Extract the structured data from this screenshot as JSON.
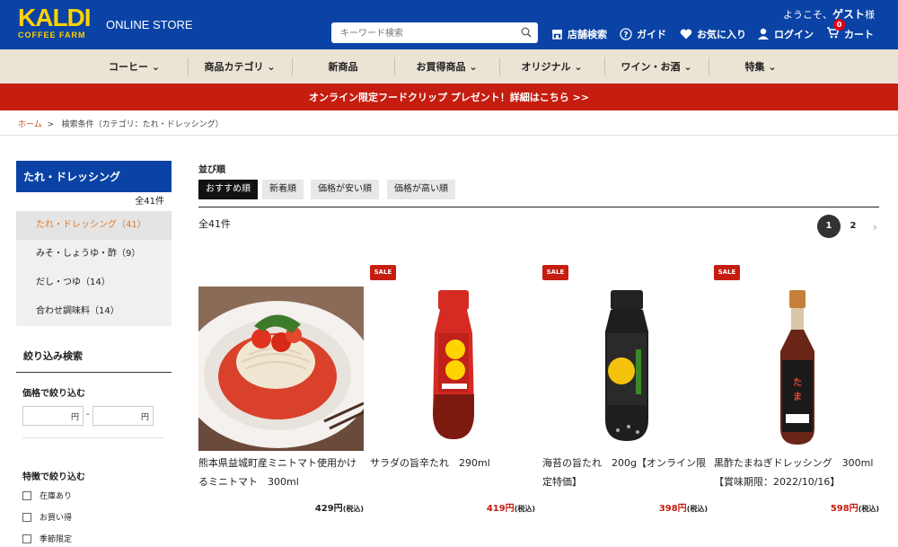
{
  "header": {
    "logo_main": "KALDI",
    "logo_sub": "COFFEE FARM",
    "store_label": "ONLINE STORE",
    "search_placeholder": "キーワード検索",
    "welcome_prefix": "ようこそ、",
    "welcome_user": "ゲスト",
    "welcome_suffix": "様",
    "nav": {
      "store_search": "店舗検索",
      "guide": "ガイド",
      "favorites": "お気に入り",
      "login": "ログイン",
      "cart": "カート",
      "cart_count": "0"
    }
  },
  "menu": [
    "コーヒー",
    "商品カテゴリ",
    "新商品",
    "お買得商品",
    "オリジナル",
    "ワイン・お酒",
    "特集"
  ],
  "promo": "オンライン限定フードクリップ プレゼント！詳細はこちら >>",
  "breadcrumb": {
    "home": "ホーム",
    "current": "検索条件（カテゴリ：たれ・ドレッシング）"
  },
  "sidebar": {
    "title": "たれ・ドレッシング",
    "count": "全41件",
    "items": [
      {
        "label": "たれ・ドレッシング（41）"
      },
      {
        "label": "みそ・しょうゆ・酢（9）"
      },
      {
        "label": "だし・つゆ（14）"
      },
      {
        "label": "合わせ調味料（14）"
      }
    ],
    "filter_title": "絞り込み検索",
    "price_title": "価格で絞り込む",
    "price_unit": "円",
    "price_sep": "-",
    "feature_title": "特徴で絞り込む",
    "features": [
      "在庫あり",
      "お買い得",
      "季節限定"
    ]
  },
  "sort": {
    "label": "並び順",
    "options": [
      "おすすめ順",
      "新着順",
      "価格が安い順",
      "価格が高い順"
    ]
  },
  "results": {
    "total": "全41件",
    "pages": [
      "1",
      "2"
    ],
    "next": "›"
  },
  "products": [
    {
      "name": "熊本県益城町産ミニトマト使用かけるミニトマト　300ml",
      "price": "429円",
      "tax": "(税込)",
      "sale": ""
    },
    {
      "name": "サラダの旨辛たれ　290ml",
      "price": "419円",
      "tax": "(税込)",
      "sale": "SALE"
    },
    {
      "name": "海苔の旨たれ　200g【オンライン限定特価】",
      "price": "398円",
      "tax": "(税込)",
      "sale": "SALE"
    },
    {
      "name": "黒酢たまねぎドレッシング　300ml【賞味期限：2022/10/16】",
      "price": "598円",
      "tax": "(税込)",
      "sale": "SALE"
    }
  ],
  "colors": {
    "brand_blue": "#0a43a5",
    "logo_yellow": "#ffd200",
    "promo_red": "#c51d10",
    "menu_beige": "#ebe3d4",
    "active_orange": "#e07a25"
  }
}
